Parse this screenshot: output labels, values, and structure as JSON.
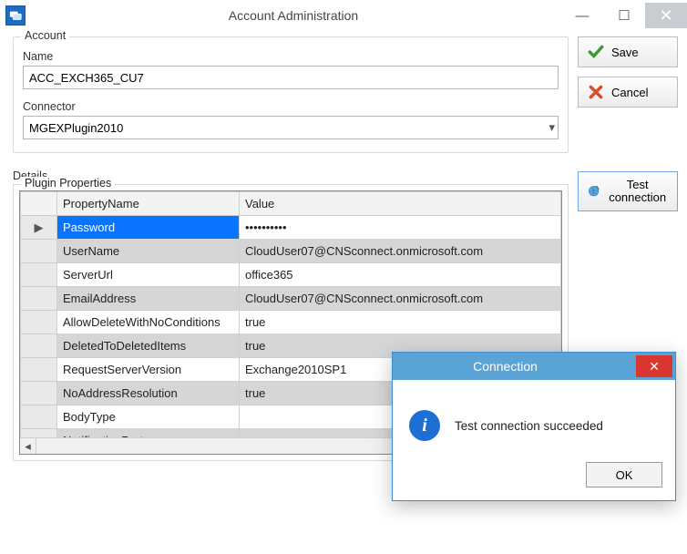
{
  "window": {
    "title": "Account Administration"
  },
  "account": {
    "legend": "Account",
    "name_label": "Name",
    "name_value": "ACC_EXCH365_CU7",
    "connector_label": "Connector",
    "connector_value": "MGEXPlugin2010"
  },
  "details": {
    "label": "Details",
    "plugin_legend": "Plugin Properties",
    "columns": {
      "rowhdr": "",
      "prop": "PropertyName",
      "val": "Value"
    },
    "rows": [
      {
        "prop": "Password",
        "val": "••••••••••",
        "selected": true,
        "alt": false,
        "marker": "▶"
      },
      {
        "prop": "UserName",
        "val": "CloudUser07@CNSconnect.onmicrosoft.com",
        "alt": true
      },
      {
        "prop": "ServerUrl",
        "val": "office365",
        "alt": false
      },
      {
        "prop": "EmailAddress",
        "val": "CloudUser07@CNSconnect.onmicrosoft.com",
        "alt": true
      },
      {
        "prop": "AllowDeleteWithNoConditions",
        "val": "true",
        "alt": false
      },
      {
        "prop": "DeletedToDeletedItems",
        "val": "true",
        "alt": true
      },
      {
        "prop": "RequestServerVersion",
        "val": "Exchange2010SP1",
        "alt": false
      },
      {
        "prop": "NoAddressResolution",
        "val": "true",
        "alt": true
      },
      {
        "prop": "BodyType",
        "val": "",
        "alt": false
      },
      {
        "prop": "NotificationPort",
        "val": "",
        "alt": true,
        "cut": true
      }
    ]
  },
  "buttons": {
    "save": "Save",
    "cancel": "Cancel",
    "test": "Test connection"
  },
  "dialog": {
    "title": "Connection",
    "message": "Test connection succeeded",
    "ok": "OK"
  }
}
